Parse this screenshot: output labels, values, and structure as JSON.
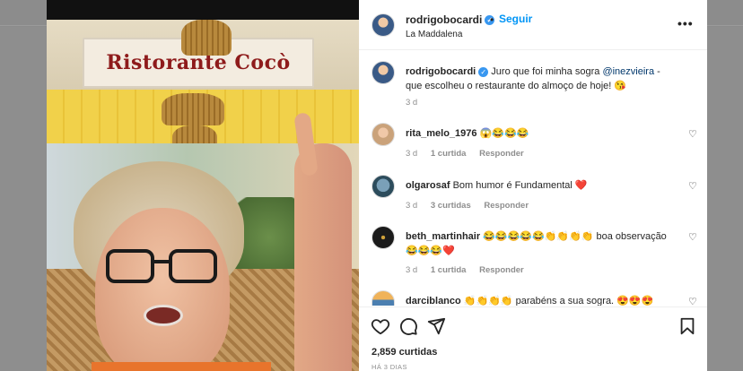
{
  "post": {
    "username": "rodrigobocardi",
    "follow_label": "Seguir",
    "separator": "•",
    "location": "La Maddalena",
    "more_label": "•••",
    "sign_text": "Ristorante Cocò"
  },
  "caption": {
    "username": "rodrigobocardi",
    "text_before": "Juro que foi minha sogra ",
    "mention": "@inezvieira",
    "text_after": " - que escolheu o restaurante do almoço de hoje! 😘",
    "time": "3 d"
  },
  "comments": [
    {
      "username": "rita_melo_1976",
      "text": "😱😂😂😂",
      "time": "3 d",
      "likes": "1 curtida",
      "reply": "Responder"
    },
    {
      "username": "olgarosaf",
      "text": "Bom humor é Fundamental ❤️",
      "time": "3 d",
      "likes": "3 curtidas",
      "reply": "Responder"
    },
    {
      "username": "beth_martinhair",
      "text": "😂😂😂😂😂👏👏👏👏 boa observação 😂😂😂❤️",
      "time": "3 d",
      "likes": "1 curtida",
      "reply": "Responder"
    },
    {
      "username": "darciblanco",
      "text": "👏👏👏👏 parabéns a sua sogra. 😍😍😍",
      "time": "",
      "likes": "",
      "reply": ""
    }
  ],
  "footer": {
    "likes": "2,859 curtidas",
    "ago": "HÁ 3 DIAS"
  },
  "icons": [
    "heart-icon",
    "comment-icon",
    "share-icon",
    "bookmark-icon"
  ]
}
